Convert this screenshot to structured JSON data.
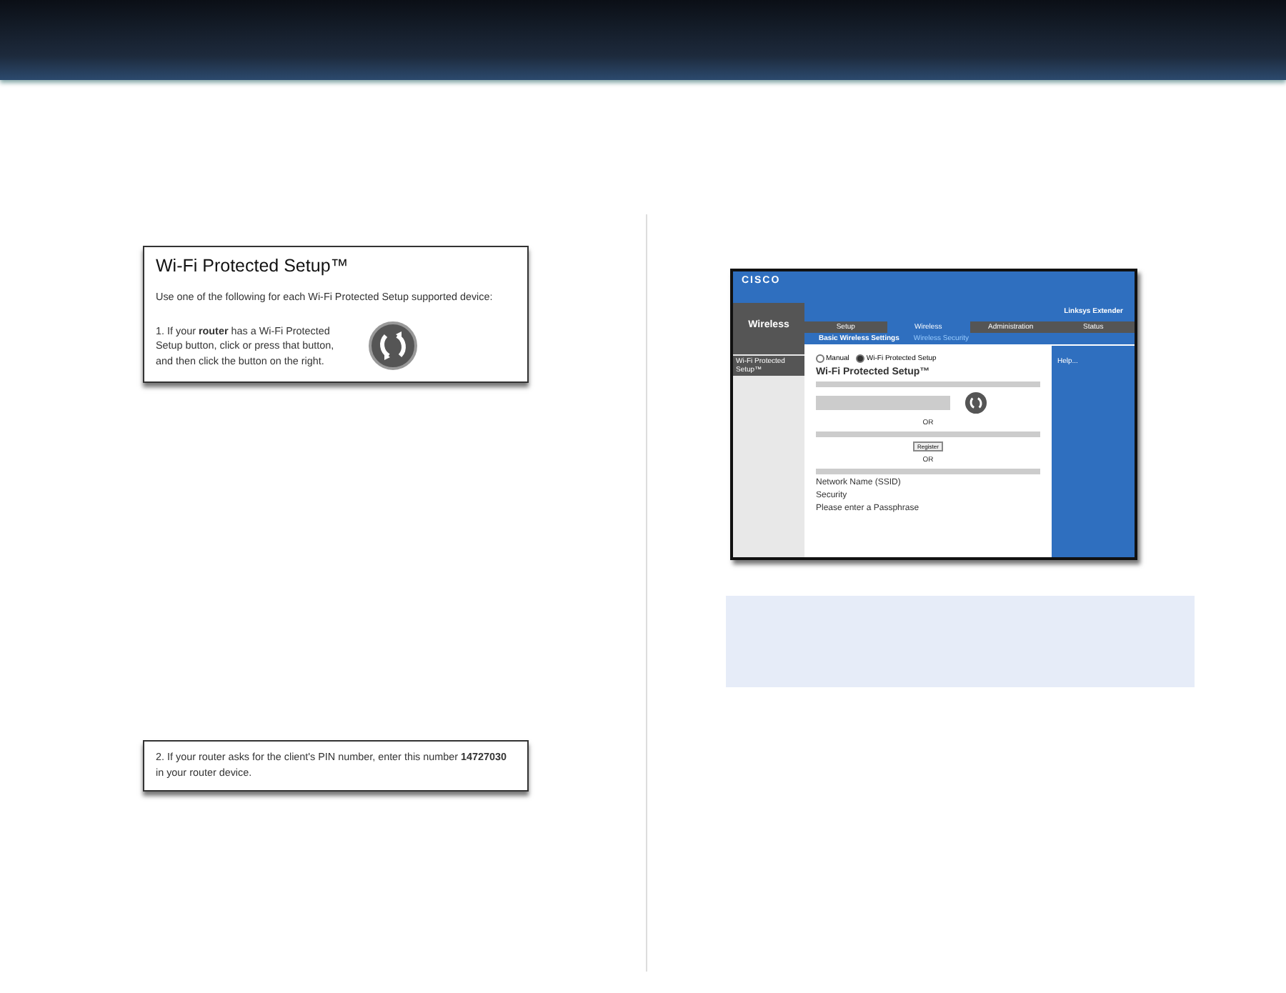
{
  "wps_panel": {
    "title": "Wi-Fi Protected Setup™",
    "intro": "Use one of the following for each Wi-Fi Protected Setup supported device:",
    "step": "1. If your **router** has a Wi-Fi Protected Setup button, click or press that button, and then click the button on the right."
  },
  "pin_panel": {
    "text": "2. If your router asks for the client's PIN number, enter this number **14727030** in your router device."
  },
  "router_screenshot": {
    "logo": "CISCO",
    "section": "Wireless",
    "product": "Linksys Extender",
    "tabs": [
      {
        "label": "Setup",
        "selected": false
      },
      {
        "label": "Wireless",
        "selected": true
      },
      {
        "label": "Administration",
        "selected": false
      },
      {
        "label": "Status",
        "selected": false
      }
    ],
    "subtabs": [
      {
        "label": "Basic Wireless Settings",
        "selected": true
      },
      {
        "label": "Wireless Security",
        "selected": false
      }
    ],
    "sidebar_item": "Wi-Fi Protected Setup™",
    "modes": [
      {
        "label": "Manual",
        "selected": false
      },
      {
        "label": "Wi-Fi Protected Setup",
        "selected": true
      }
    ],
    "title": "Wi-Fi Protected Setup™",
    "or_labels": [
      "OR",
      "OR"
    ],
    "register_button": "Register",
    "fields": [
      {
        "label": "Network Name (SSID)"
      },
      {
        "label": "Security"
      },
      {
        "label": "Please enter a Passphrase"
      }
    ],
    "help_link": "Help..."
  }
}
